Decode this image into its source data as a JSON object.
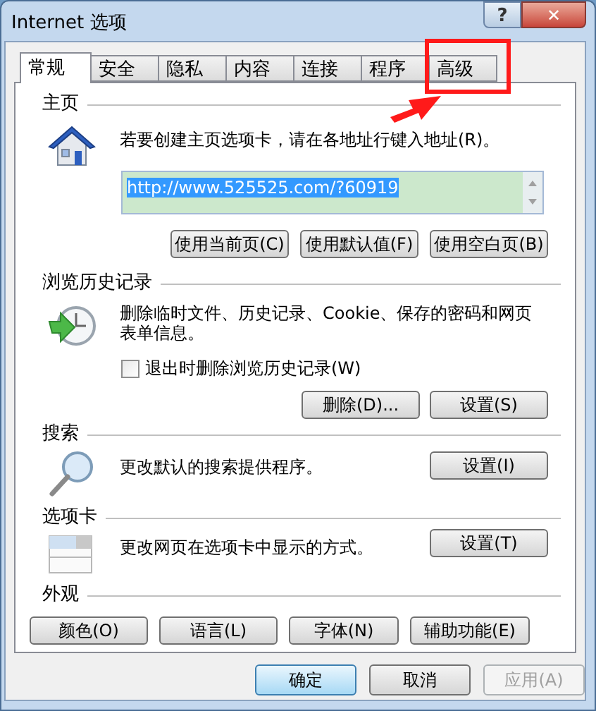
{
  "window": {
    "title": "Internet 选项",
    "help": "?",
    "close": "✕"
  },
  "tabs": [
    {
      "label": "常规",
      "selected": true
    },
    {
      "label": "安全",
      "selected": false
    },
    {
      "label": "隐私",
      "selected": false
    },
    {
      "label": "内容",
      "selected": false
    },
    {
      "label": "连接",
      "selected": false
    },
    {
      "label": "程序",
      "selected": false
    },
    {
      "label": "高级",
      "selected": false
    }
  ],
  "home_page": {
    "heading": "主页",
    "description": "若要创建主页选项卡，请在各地址行键入地址(R)。",
    "url": "http://www.525525.com/?60919",
    "buttons": [
      "使用当前页(C)",
      "使用默认值(F)",
      "使用空白页(B)"
    ]
  },
  "browsing_history": {
    "heading": "浏览历史记录",
    "description": "删除临时文件、历史记录、Cookie、保存的密码和网页表单信息。",
    "checkbox": {
      "label": "退出时删除浏览历史记录(W)",
      "checked": false
    },
    "buttons": [
      "删除(D)...",
      "设置(S)"
    ]
  },
  "search": {
    "heading": "搜索",
    "description": "更改默认的搜索提供程序。",
    "button": "设置(I)"
  },
  "tabs_section": {
    "heading": "选项卡",
    "description": "更改网页在选项卡中显示的方式。",
    "button": "设置(T)"
  },
  "appearance": {
    "heading": "外观",
    "buttons": [
      "颜色(O)",
      "语言(L)",
      "字体(N)",
      "辅助功能(E)"
    ]
  },
  "footer": [
    {
      "label": "确定",
      "default": true,
      "disabled": false
    },
    {
      "label": "取消",
      "default": false,
      "disabled": false
    },
    {
      "label": "应用(A)",
      "default": false,
      "disabled": true
    }
  ]
}
